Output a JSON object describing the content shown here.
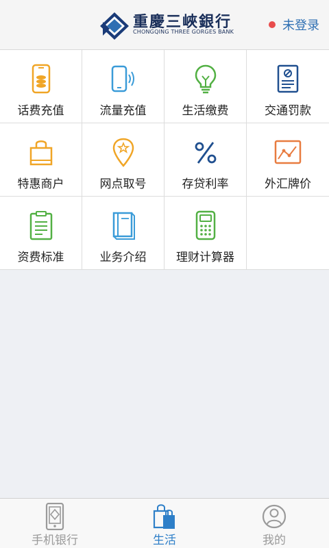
{
  "header": {
    "logo_cn": "重慶三峽銀行",
    "logo_en": "CHONGQING THREE GORGES BANK",
    "login_label": "未登录",
    "status_dot_color": "#e84c4c"
  },
  "grid": {
    "items": [
      {
        "label": "话费充值",
        "icon": "phone-coins-icon"
      },
      {
        "label": "流量充值",
        "icon": "phone-signal-icon"
      },
      {
        "label": "生活缴费",
        "icon": "lightbulb-icon"
      },
      {
        "label": "交通罚款",
        "icon": "ticket-icon"
      },
      {
        "label": "特惠商户",
        "icon": "shopping-bag-icon"
      },
      {
        "label": "网点取号",
        "icon": "location-pin-icon"
      },
      {
        "label": "存贷利率",
        "icon": "percent-icon"
      },
      {
        "label": "外汇牌价",
        "icon": "line-chart-icon"
      },
      {
        "label": "资费标准",
        "icon": "clipboard-icon"
      },
      {
        "label": "业务介绍",
        "icon": "book-icon"
      },
      {
        "label": "理财计算器",
        "icon": "calculator-icon"
      }
    ]
  },
  "tabbar": {
    "tabs": [
      {
        "label": "手机银行",
        "icon": "mobile-bank-icon",
        "active": false
      },
      {
        "label": "生活",
        "icon": "shopping-bags-icon",
        "active": true
      },
      {
        "label": "我的",
        "icon": "user-icon",
        "active": false
      }
    ]
  },
  "colors": {
    "accent": "#2e7fc8",
    "orange": "#f0a526",
    "blue": "#3a9bd8",
    "green": "#52b043",
    "navy": "#1f4f8f",
    "coral": "#e87b3f"
  }
}
